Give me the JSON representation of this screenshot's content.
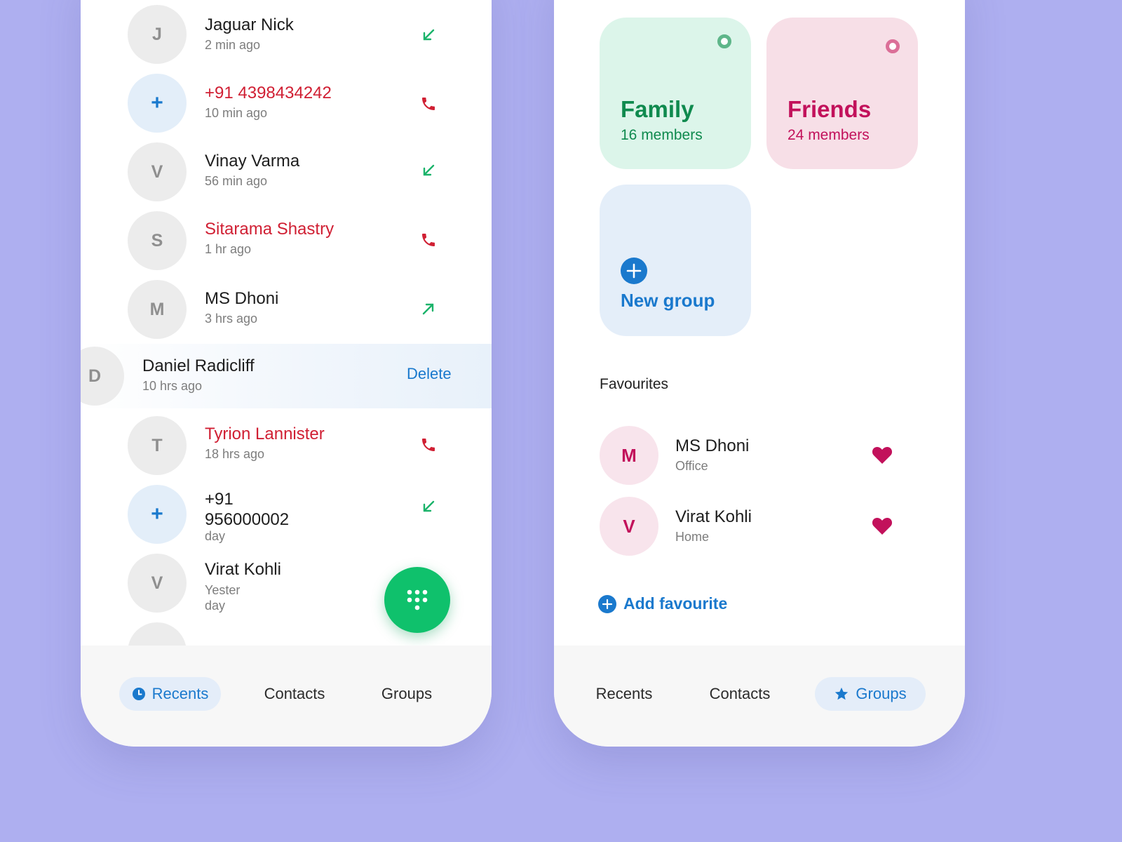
{
  "recents": {
    "calls": [
      {
        "initial": "J",
        "name": "Jaguar Nick",
        "time": "2 min ago",
        "type": "incoming",
        "missed": false
      },
      {
        "initial": "+",
        "name": "+91 4398434242",
        "time": "10 min ago",
        "type": "missed",
        "missed": true
      },
      {
        "initial": "V",
        "name": "Vinay Varma",
        "time": "56 min ago",
        "type": "incoming",
        "missed": false
      },
      {
        "initial": "S",
        "name": "Sitarama Shastry",
        "time": "1 hr ago",
        "type": "missed",
        "missed": true
      },
      {
        "initial": "M",
        "name": "MS Dhoni",
        "time": "3 hrs ago",
        "type": "outgoing",
        "missed": false
      },
      {
        "initial": "D",
        "name": "Daniel Radicliff",
        "time": "10 hrs ago",
        "type": "swiped",
        "missed": false
      },
      {
        "initial": "T",
        "name": "Tyrion Lannister",
        "time": "18 hrs ago",
        "type": "missed",
        "missed": true
      },
      {
        "initial": "+",
        "name_line1": "+91",
        "name_line2": "956000002",
        "time": "day",
        "type": "incoming",
        "missed": false
      },
      {
        "initial": "V",
        "name": "Virat Kohli",
        "time_line1": "Yester",
        "time_line2": "day",
        "type": "none",
        "missed": false
      }
    ],
    "delete_label": "Delete",
    "fab_icon": "dialpad-icon"
  },
  "groups": {
    "cards": [
      {
        "title": "Family",
        "subtitle": "16 members",
        "bg": "#dcf5ea",
        "color": "#0f8a4e",
        "dot": "#5fb68a"
      },
      {
        "title": "Friends",
        "subtitle": "24 members",
        "bg": "#f7dfe7",
        "color": "#c2115b",
        "dot": "#db6f98"
      },
      {
        "title": "New group",
        "bg": "#e4eef9",
        "color": "#1a79cd",
        "icon": "add-circle-icon"
      }
    ],
    "favourites_title": "Favourites",
    "favourites": [
      {
        "initial": "M",
        "name": "MS Dhoni",
        "label": "Office"
      },
      {
        "initial": "V",
        "name": "Virat Kohli",
        "label": "Home"
      }
    ],
    "add_favourite": "Add favourite"
  },
  "nav_left": [
    {
      "label": "Recents",
      "active": true,
      "icon": "clock-icon"
    },
    {
      "label": "Contacts",
      "active": false
    },
    {
      "label": "Groups",
      "active": false
    }
  ],
  "nav_right": [
    {
      "label": "Recents",
      "active": false
    },
    {
      "label": "Contacts",
      "active": false
    },
    {
      "label": "Groups",
      "active": true,
      "icon": "star-icon"
    }
  ],
  "colors": {
    "accent": "#1a79cd",
    "missed": "#d01f33",
    "incoming": "#1ab36a",
    "fab": "#0fc16c",
    "favourite": "#c2115b",
    "background": "#aeaff0"
  }
}
